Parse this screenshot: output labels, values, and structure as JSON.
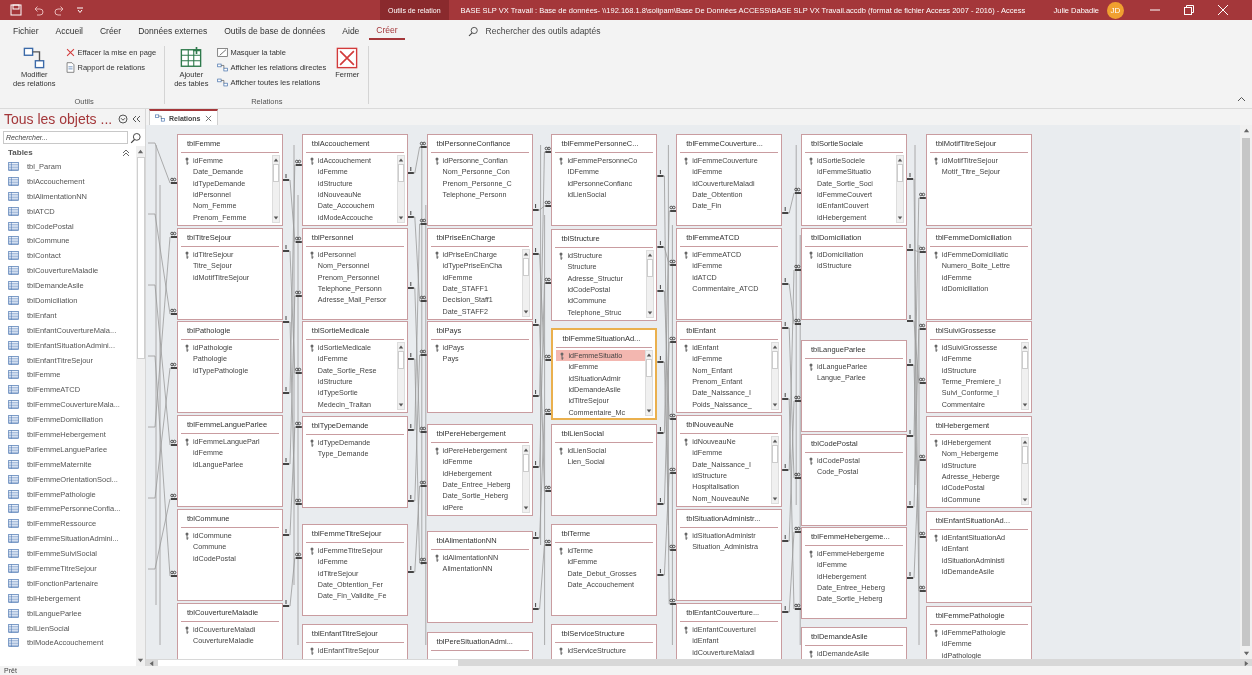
{
  "title_bar": {
    "context_label": "Outils de relation",
    "title": "BASE SLP VX Travail : Base de données- \\\\192.168.1.8\\solipam\\Base De Données ACCESS\\BASE SLP VX Travail.accdb (format de fichier Access 2007 - 2016)  -  Access",
    "user": "Julie Dabadie",
    "initials": "JD"
  },
  "menu_tabs": [
    {
      "label": "Fichier",
      "selected": false
    },
    {
      "label": "Accueil",
      "selected": false
    },
    {
      "label": "Créer",
      "selected": false
    },
    {
      "label": "Données externes",
      "selected": false
    },
    {
      "label": "Outils de base de données",
      "selected": false
    },
    {
      "label": "Aide",
      "selected": false
    },
    {
      "label": "Créer",
      "selected": true
    }
  ],
  "tell_me": {
    "placeholder": "Rechercher des outils adaptés"
  },
  "ribbon": {
    "groups": [
      {
        "label": "Outils",
        "items": [
          {
            "kind": "large",
            "label": "Modifier\ndes relations"
          },
          {
            "kind": "small",
            "label": "Effacer la mise en page"
          },
          {
            "kind": "small",
            "label": "Rapport de relations"
          }
        ]
      },
      {
        "label": "Relations",
        "items": [
          {
            "kind": "large",
            "label": "Ajouter\ndes tables"
          },
          {
            "kind": "small",
            "label": "Masquer la table"
          },
          {
            "kind": "small",
            "label": "Afficher les relations directes"
          },
          {
            "kind": "small",
            "label": "Afficher toutes les relations"
          },
          {
            "kind": "large",
            "label": "Fermer"
          }
        ]
      }
    ]
  },
  "nav_pane": {
    "title": "Tous les objets ...",
    "search": {
      "placeholder": "Rechercher..."
    },
    "section": "Tables",
    "items": [
      "tbl_Param",
      "tblAccouchement",
      "tblAlimentationNN",
      "tblATCD",
      "tblCodePostal",
      "tblCommune",
      "tblContact",
      "tblCouvertureMaladie",
      "tblDemandeAsile",
      "tblDomiciliation",
      "tblEnfant",
      "tblEnfantCouvertureMala...",
      "tblEnfantSituationAdmini...",
      "tblEnfantTitreSejour",
      "tblFemme",
      "tblFemmeATCD",
      "tblFemmeCouvertureMala...",
      "tblFemmeDomiciliation",
      "tblFemmeHebergement",
      "tblFemmeLangueParlee",
      "tblFemmeMaternite",
      "tblFemmeOrientationSoci...",
      "tblFemmePathologie",
      "tblFemmePersonneConfia...",
      "tblFemmeRessource",
      "tblFemmeSituationAdmini...",
      "tblFemmeSuiviSocial",
      "tblFemmeTitreSejour",
      "tblFonctionPartenaire",
      "tblHebergement",
      "tblLangueParlee",
      "tblLienSocial",
      "tblModeAccouchement"
    ]
  },
  "document_tabs": [
    {
      "label": "Relations",
      "selected": true
    }
  ],
  "diagram": {
    "columns": [
      {
        "tables": [
          {
            "name": "tblFemme",
            "selected": false,
            "fields": [
              "idFemme",
              "Date_Demande",
              "idTypeDemande",
              "idPersonnel",
              "Nom_Femme",
              "Prenom_Femme"
            ]
          },
          {
            "name": "tblTitreSejour",
            "selected": false,
            "fields": [
              "idTitreSejour",
              "Titre_Sejour",
              "idMotifTitreSejour"
            ]
          },
          {
            "name": "tblPathologie",
            "selected": false,
            "fields": [
              "idPathologie",
              "Pathologie",
              "idTypePathologie"
            ]
          },
          {
            "name": "tblFemmeLangueParlee",
            "selected": false,
            "fields": [
              "idFemmeLangueParl",
              "idFemme",
              "idLangueParlee"
            ]
          },
          {
            "name": "tblCommune",
            "selected": false,
            "fields": [
              "idCommune",
              "Commune",
              "idCodePostal"
            ]
          },
          {
            "name": "tblCouvertureMaladie",
            "selected": false,
            "fields": [
              "idCouvertureMaladi",
              "CouvertureMaladie"
            ]
          }
        ]
      },
      {
        "tables": [
          {
            "name": "tblAccouchement",
            "selected": false,
            "fields": [
              "idAccouchement",
              "idFemme",
              "idStructure",
              "idNouveauNe",
              "Date_Accouchem",
              "idModeAccouche"
            ]
          },
          {
            "name": "tblPersonnel",
            "selected": false,
            "fields": [
              "idPersonnel",
              "Nom_Personnel",
              "Prenom_Personnel",
              "Telephone_Personn",
              "Adresse_Mail_Persor"
            ]
          },
          {
            "name": "tblSortieMedicale",
            "selected": false,
            "fields": [
              "idSortieMedicale",
              "idFemme",
              "Date_Sortie_Rese",
              "idStructure",
              "idTypeSortie",
              "Medecin_Traitan"
            ]
          },
          {
            "name": "tblTypeDemande",
            "selected": false,
            "fields": [
              "idTypeDemande",
              "Type_Demande"
            ]
          },
          {
            "name": "tblFemmeTitreSejour",
            "selected": false,
            "fields": [
              "idFemmeTitreSejour",
              "idFemme",
              "idTitreSejour",
              "Date_Obtention_Fer",
              "Date_Fin_Validite_Fe"
            ]
          },
          {
            "name": "tblEnfantTitreSejour",
            "selected": false,
            "fields": [
              "idEnfantTitreSejour"
            ]
          }
        ]
      },
      {
        "tables": [
          {
            "name": "tblPersonneConfiance",
            "selected": false,
            "fields": [
              "idPersonne_Confian",
              "Nom_Personne_Con",
              "Prenom_Personne_C",
              "Telephone_Personn"
            ]
          },
          {
            "name": "tblPriseEnCharge",
            "selected": false,
            "fields": [
              "idPriseEnCharge",
              "idTypePriseEnCha",
              "idFemme",
              "Date_STAFF1",
              "Decision_Staff1",
              "Date_STAFF2"
            ]
          },
          {
            "name": "tblPays",
            "selected": false,
            "fields": [
              "idPays",
              "Pays"
            ]
          },
          {
            "name": "tblPereHebergement",
            "selected": false,
            "fields": [
              "idPereHebergement",
              "idFemme",
              "idHebergement",
              "Date_Entree_Heberg",
              "Date_Sortie_Heberg",
              "idPere"
            ]
          },
          {
            "name": "tblAlimentationNN",
            "selected": false,
            "fields": [
              "idAlimentationNN",
              "AlimentationNN"
            ]
          },
          {
            "name": "tblPereSituationAdmi...",
            "selected": false
          }
        ]
      },
      {
        "tables": [
          {
            "name": "tblFemmePersonneC...",
            "selected": false,
            "fields": [
              "idFemmePersonneCo",
              "IDFemme",
              "idPersonneConfianc",
              "idLienSocial"
            ]
          },
          {
            "name": "tblStructure",
            "selected": false,
            "fields": [
              "idStructure",
              "Structure",
              "Adresse_Structur",
              "idCodePostal",
              "idCommune",
              "Telephone_Struc"
            ]
          },
          {
            "name": "tblFemmeSituationAd...",
            "selected": true,
            "fields": [
              "idFemmeSituatio",
              "idFemme",
              "idSituationAdmir",
              "idDemandeAsile",
              "idTitreSejour",
              "Commentaire_Mc"
            ]
          },
          {
            "name": "tblLienSocial",
            "selected": false,
            "fields": [
              "idLienSocial",
              "Lien_Social"
            ]
          },
          {
            "name": "tblTerme",
            "selected": false,
            "fields": [
              "idTerme",
              "idFemme",
              "Date_Debut_Grosses",
              "Date_Accouchement"
            ]
          },
          {
            "name": "tblServiceStructure",
            "selected": false,
            "fields": [
              "idServiceStructure"
            ]
          }
        ]
      },
      {
        "tables": [
          {
            "name": "tblFemmeCouverture...",
            "selected": false,
            "fields": [
              "idFemmeCouverture",
              "idFemme",
              "idCouvertureMaladi",
              "Date_Obtention",
              "Date_Fin"
            ]
          },
          {
            "name": "tblFemmeATCD",
            "selected": false,
            "fields": [
              "idFemmeATCD",
              "idFemme",
              "idATCD",
              "Commentaire_ATCD"
            ]
          },
          {
            "name": "tblEnfant",
            "selected": false,
            "fields": [
              "idEnfant",
              "idFemme",
              "Nom_Enfant",
              "Prenom_Enfant",
              "Date_Naissance_I",
              "Poids_Naissance_"
            ]
          },
          {
            "name": "tblNouveauNe",
            "selected": false,
            "fields": [
              "idNouveauNe",
              "idFemme",
              "Date_Naissance_I",
              "idStructure",
              "Hospitalisation",
              "Nom_NouveauNe"
            ]
          },
          {
            "name": "tblSituationAdministr...",
            "selected": false,
            "fields": [
              "idSituationAdministr",
              "Situation_Administra"
            ]
          },
          {
            "name": "tblEnfantCouverture...",
            "selected": false,
            "fields": [
              "idEnfantCouvertureI",
              "idEnfant",
              "idCouvertureMaladi"
            ]
          }
        ]
      },
      {
        "tables": [
          {
            "name": "tblSortieSociale",
            "selected": false,
            "fields": [
              "idSortieSociele",
              "idFemmeSituatio",
              "Date_Sortie_Soci",
              "idFemmeCouvert",
              "idEnfantCouvert",
              "idHebergement"
            ]
          },
          {
            "name": "tblDomiciliation",
            "selected": false,
            "fields": [
              "idDomiciliation",
              "idStructure"
            ]
          },
          {
            "name": "tblLangueParlee",
            "selected": false,
            "fields": [
              "idLangueParlee",
              "Langue_Parlee"
            ]
          },
          {
            "name": "tblCodePostal",
            "selected": false,
            "fields": [
              "idCodePostal",
              "Code_Postal"
            ]
          },
          {
            "name": "tblFemmeHebergeme...",
            "selected": false,
            "fields": [
              "idFemmeHebergeme",
              "idFemme",
              "idHebergement",
              "Date_Entree_Heberg",
              "Date_Sortie_Heberg"
            ]
          },
          {
            "name": "tblDemandeAsile",
            "selected": false,
            "fields": [
              "idDemandeAsile"
            ]
          }
        ]
      },
      {
        "tables": [
          {
            "name": "tblMotifTitreSejour",
            "selected": false,
            "fields": [
              "idMotifTitreSejour",
              "Motif_Titre_Sejour"
            ]
          },
          {
            "name": "tblFemmeDomiciliation",
            "selected": false,
            "fields": [
              "idFemmeDomiciliatic",
              "Numero_Boite_Lettre",
              "idFemme",
              "idDomiciliation"
            ]
          },
          {
            "name": "tblSuiviGrossesse",
            "selected": false,
            "fields": [
              "idSuiviGrossesse",
              "idFemme",
              "idStructure",
              "Terme_Premiere_I",
              "Suivi_Conforme_I",
              "Commentaire"
            ]
          },
          {
            "name": "tblHebergement",
            "selected": false,
            "fields": [
              "idHebergement",
              "Nom_Hebergeme",
              "idStructure",
              "Adresse_Heberge",
              "idCodePostal",
              "idCommune"
            ]
          },
          {
            "name": "tblEnfantSituationAd...",
            "selected": false,
            "fields": [
              "idEnfantSituationAd",
              "idEnfant",
              "idSituationAdministi",
              "idDemandeAsile"
            ]
          },
          {
            "name": "tblFemmePathologie",
            "selected": false,
            "fields": [
              "idFemmePathologie",
              "idFemme",
              "idPathologie"
            ]
          }
        ]
      }
    ]
  },
  "status_bar": {
    "text": "Prêt"
  }
}
